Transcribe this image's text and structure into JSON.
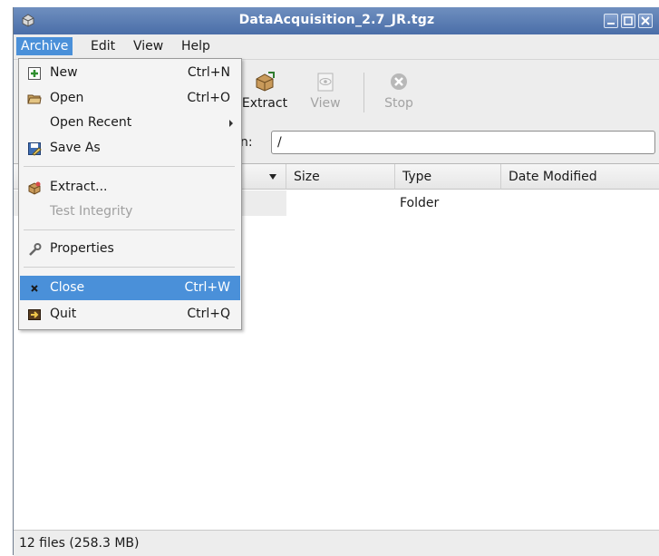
{
  "window": {
    "title": "DataAcquisition_2.7_JR.tgz",
    "app_icon": "archive-manager-icon",
    "controls": [
      "minimize-icon",
      "maximize-icon",
      "close-icon"
    ]
  },
  "menubar": {
    "items": [
      {
        "label": "Archive",
        "active": true
      },
      {
        "label": "Edit"
      },
      {
        "label": "View"
      },
      {
        "label": "Help"
      }
    ]
  },
  "toolbar": {
    "extract_label": "Extract",
    "view_label": "View",
    "stop_label": "Stop"
  },
  "location": {
    "label": "n:",
    "value": "/"
  },
  "file_list": {
    "columns": [
      "Size",
      "Type",
      "Date Modified"
    ],
    "rows": [
      {
        "size": "",
        "type": "Folder",
        "date": ""
      }
    ]
  },
  "status": {
    "text": "12 files (258.3 MB)"
  },
  "archive_menu": {
    "items": [
      {
        "label": "New",
        "accel": "Ctrl+N",
        "icon": "new-archive-icon"
      },
      {
        "label": "Open",
        "accel": "Ctrl+O",
        "icon": "open-folder-icon"
      },
      {
        "label": "Open Recent",
        "accel": "",
        "icon": ""
      },
      {
        "label": "Save As",
        "accel": "",
        "icon": "save-as-icon"
      },
      {
        "label": "Extract...",
        "accel": "",
        "icon": "extract-icon"
      },
      {
        "label": "Test Integrity",
        "accel": "",
        "icon": "",
        "disabled": true
      },
      {
        "label": "Properties",
        "accel": "",
        "icon": "properties-icon"
      },
      {
        "label": "Close",
        "accel": "Ctrl+W",
        "icon": "close-icon",
        "highlighted": true
      },
      {
        "label": "Quit",
        "accel": "Ctrl+Q",
        "icon": "quit-icon"
      }
    ]
  },
  "colors": {
    "titlebar": "#4a6ea8",
    "highlight": "#4a90d9",
    "background": "#ededed"
  }
}
